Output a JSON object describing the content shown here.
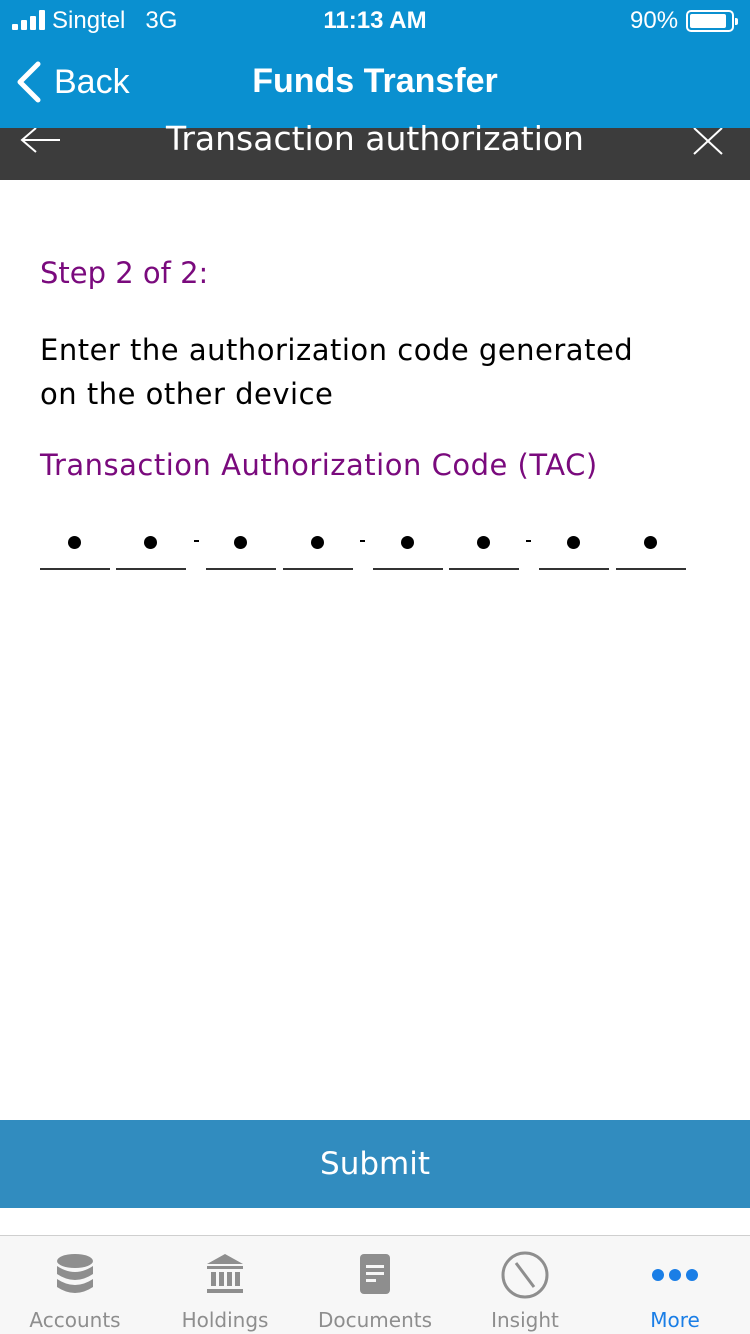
{
  "status_bar": {
    "carrier": "Singtel",
    "network": "3G",
    "time": "11:13 AM",
    "battery": "90%",
    "battery_level": 0.9
  },
  "nav": {
    "back_label": "Back",
    "title": "Funds Transfer"
  },
  "sub_header": {
    "title": "Transaction authorization"
  },
  "content": {
    "step": "Step 2 of 2:",
    "instruction": "Enter the authorization code generated on the other device",
    "tac_label": "Transaction Authorization Code (TAC)",
    "tac_digits": [
      "•",
      "•",
      "•",
      "•",
      "•",
      "•",
      "•",
      "•"
    ]
  },
  "submit_label": "Submit",
  "tabbar": {
    "items": [
      {
        "label": "Accounts",
        "icon": "database-icon",
        "active": false
      },
      {
        "label": "Holdings",
        "icon": "bank-icon",
        "active": false
      },
      {
        "label": "Documents",
        "icon": "document-icon",
        "active": false
      },
      {
        "label": "Insight",
        "icon": "compass-icon",
        "active": false
      },
      {
        "label": "More",
        "icon": "more-dots-icon",
        "active": true
      }
    ]
  },
  "colors": {
    "nav_blue": "#0a90d0",
    "sub_header": "#3c3c3c",
    "accent_purple": "#7a0a7d",
    "submit_blue": "#318cbf",
    "tab_active": "#1a7ee6",
    "tab_inactive": "#8e8e8e"
  }
}
